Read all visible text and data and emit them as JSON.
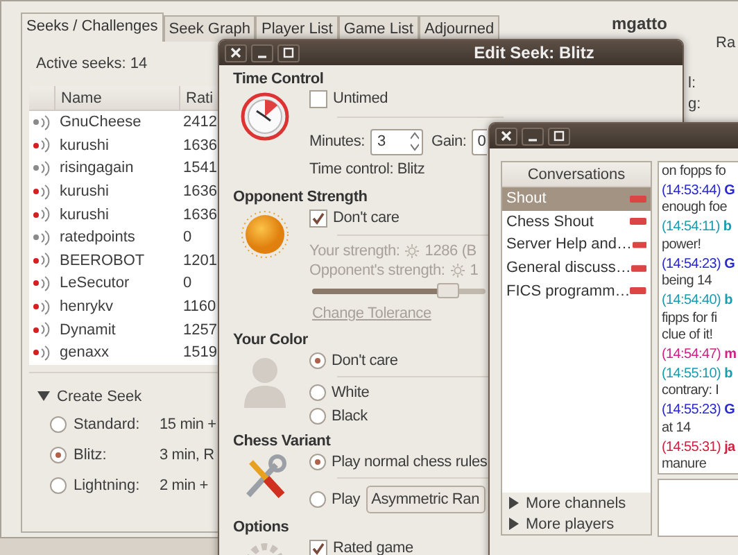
{
  "main_window": {
    "tabs": [
      {
        "label": "Seeks / Challenges",
        "selected": true
      },
      {
        "label": "Seek Graph",
        "selected": false
      },
      {
        "label": "Player List",
        "selected": false
      },
      {
        "label": "Game List",
        "selected": false
      },
      {
        "label": "Adjourned",
        "selected": false
      }
    ],
    "active_seeks": "Active seeks: 14",
    "columns": [
      "Name",
      "Rati"
    ],
    "rows": [
      {
        "name": "GnuCheese",
        "rating": "2412",
        "color": "#8a8a8a"
      },
      {
        "name": "kurushi",
        "rating": "1636",
        "color": "#d42020"
      },
      {
        "name": "risingagain",
        "rating": "1541",
        "color": "#8a8a8a"
      },
      {
        "name": "kurushi",
        "rating": "1636",
        "color": "#d42020"
      },
      {
        "name": "kurushi",
        "rating": "1636",
        "color": "#d42020"
      },
      {
        "name": "ratedpoints",
        "rating": "0",
        "color": "#8a8a8a"
      },
      {
        "name": "BEEROBOT",
        "rating": "1201",
        "color": "#d42020"
      },
      {
        "name": "LeSecutor",
        "rating": "0",
        "color": "#d42020"
      },
      {
        "name": "henrykv",
        "rating": "1160",
        "color": "#d42020"
      },
      {
        "name": "Dynamit",
        "rating": "1257",
        "color": "#d42020"
      },
      {
        "name": "genaxx",
        "rating": "1519",
        "color": "#d42020"
      }
    ],
    "create_seek": {
      "title": "Create Seek",
      "expanded": true,
      "options": [
        {
          "label": "Standard:",
          "value": "15 min +",
          "selected": false
        },
        {
          "label": "Blitz:",
          "value": "3 min, R",
          "selected": true
        },
        {
          "label": "Lightning:",
          "value": "2 min +",
          "selected": false
        }
      ]
    },
    "player": "mgatto",
    "rating_heading": "Ra",
    "rating_labels": [
      "l:",
      "g:"
    ]
  },
  "edit_seek": {
    "title": "Edit Seek: Blitz",
    "time_control": {
      "heading": "Time Control",
      "untimed": {
        "label": "Untimed",
        "checked": false
      },
      "minutes_label": "Minutes:",
      "minutes": "3",
      "gain_label": "Gain:",
      "gain": "0",
      "summary": "Time control:  Blitz"
    },
    "opponent_strength": {
      "heading": "Opponent Strength",
      "dont_care": {
        "label": "Don't care",
        "checked": true
      },
      "your_strength_label": "Your strength:",
      "your_strength": "1286  (B",
      "opponent_label": "Opponent's strength:",
      "opponent": "1",
      "level": 0.78,
      "link": "Change Tolerance"
    },
    "your_color": {
      "heading": "Your Color",
      "options": [
        {
          "label": "Don't care",
          "selected": true
        },
        {
          "label": "White",
          "selected": false
        },
        {
          "label": "Black",
          "selected": false
        }
      ]
    },
    "chess_variant": {
      "heading": "Chess Variant",
      "options": [
        {
          "label": "Play normal chess rules",
          "selected": true
        },
        {
          "label": "Play",
          "selected": false
        }
      ],
      "variant": "Asymmetric Ran"
    },
    "options": {
      "heading": "Options",
      "rated": {
        "label": "Rated game",
        "checked": true
      }
    }
  },
  "chat_window": {
    "conversations_heading": "Conversations",
    "conversations": [
      {
        "label": "Shout",
        "selected": true
      },
      {
        "label": "Chess Shout",
        "selected": false
      },
      {
        "label": "Server Help and…",
        "selected": false
      },
      {
        "label": "General discuss…",
        "selected": false
      },
      {
        "label": "FICS programm…",
        "selected": false
      }
    ],
    "expanders": [
      "More channels",
      "More players"
    ],
    "messages": [
      {
        "lines": [
          "on fopps fo"
        ]
      },
      {
        "time": "(14:53:44)",
        "name": "G",
        "color": "#2828d0",
        "lines": [
          "enough foe"
        ]
      },
      {
        "time": "(14:54:11)",
        "name": "b",
        "color": "#1a9bb0",
        "lines": [
          "power!"
        ]
      },
      {
        "time": "(14:54:23)",
        "name": "G",
        "color": "#2828d0",
        "lines": [
          "being 14"
        ]
      },
      {
        "time": "(14:54:40)",
        "name": "b",
        "color": "#1a9bb0",
        "lines": [
          "fipps for fi",
          "clue of it!"
        ]
      },
      {
        "time": "(14:54:47)",
        "name": "m",
        "color": "#d0208a"
      },
      {
        "time": "(14:55:10)",
        "name": "b",
        "color": "#1a9bb0",
        "lines": [
          "contrary: I"
        ]
      },
      {
        "time": "(14:55:23)",
        "name": "G",
        "color": "#2828d0",
        "lines": [
          "at 14"
        ]
      },
      {
        "time": "(14:55:31)",
        "name": "ja",
        "color": "#d02040",
        "lines": [
          "manure"
        ]
      }
    ]
  }
}
